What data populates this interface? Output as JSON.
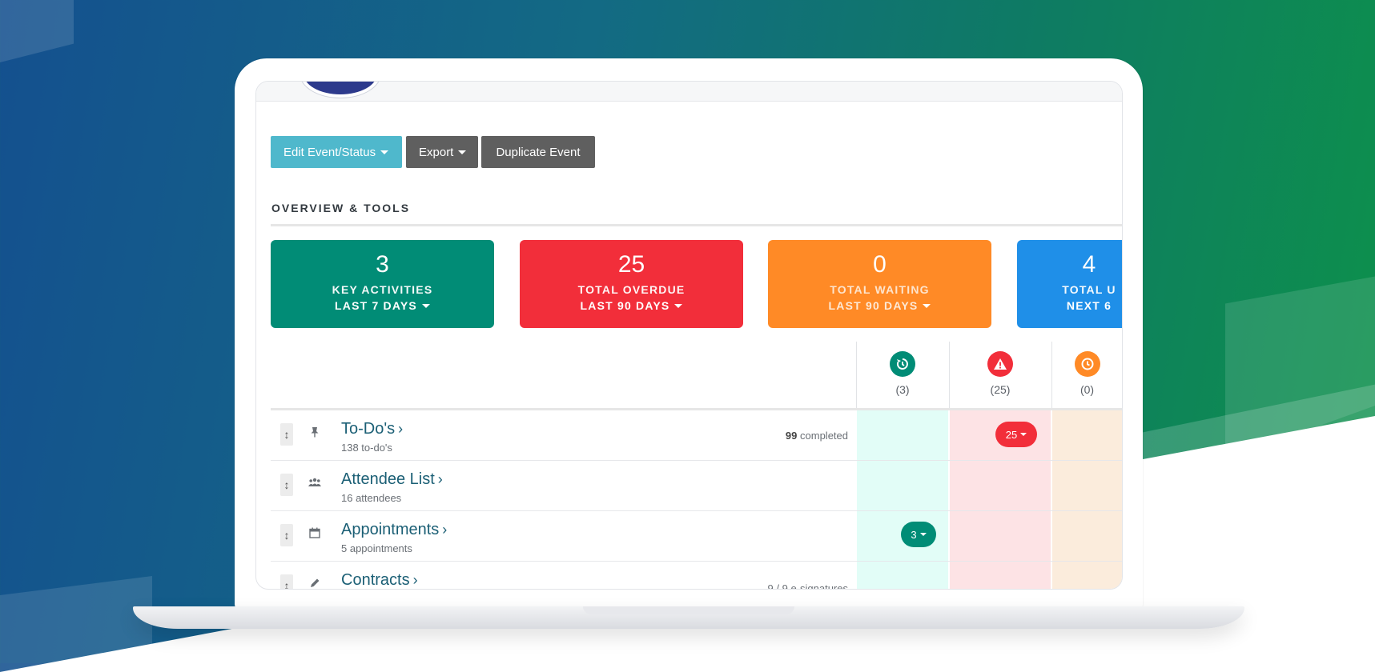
{
  "toolbar": {
    "edit_label": "Edit Event/Status",
    "export_label": "Export",
    "duplicate_label": "Duplicate Event"
  },
  "section": {
    "title": "OVERVIEW & TOOLS"
  },
  "cards": [
    {
      "value": "3",
      "label": "KEY ACTIVITIES",
      "period": "LAST 7 DAYS",
      "color": "#018c76"
    },
    {
      "value": "25",
      "label": "TOTAL OVERDUE",
      "period": "LAST 90 DAYS",
      "color": "#f22e3a"
    },
    {
      "value": "0",
      "label": "TOTAL WAITING",
      "period": "LAST 90 DAYS",
      "color": "#ff8a26"
    },
    {
      "value": "4",
      "label": "TOTAL U",
      "period": "NEXT 6",
      "color": "#1f8fe8"
    }
  ],
  "status_columns": [
    {
      "icon": "history-icon",
      "count": "(3)",
      "color": "#018c76"
    },
    {
      "icon": "warning-icon",
      "count": "(25)",
      "color": "#f22e3a"
    },
    {
      "icon": "clock-icon",
      "count": "(0)",
      "color": "#ff8a26"
    }
  ],
  "rows": [
    {
      "icon": "pin-icon",
      "title": "To-Do's",
      "subtitle": "138 to-do's",
      "right_count": "99",
      "right_label": "completed",
      "overdue_pill": "25"
    },
    {
      "icon": "users-icon",
      "title": "Attendee List",
      "subtitle": "16 attendees"
    },
    {
      "icon": "calendar-icon",
      "title": "Appointments",
      "subtitle": "5 appointments",
      "key_pill": "3"
    },
    {
      "icon": "pen-icon",
      "title": "Contracts",
      "right_text": "9 / 9 e-signatures"
    }
  ]
}
